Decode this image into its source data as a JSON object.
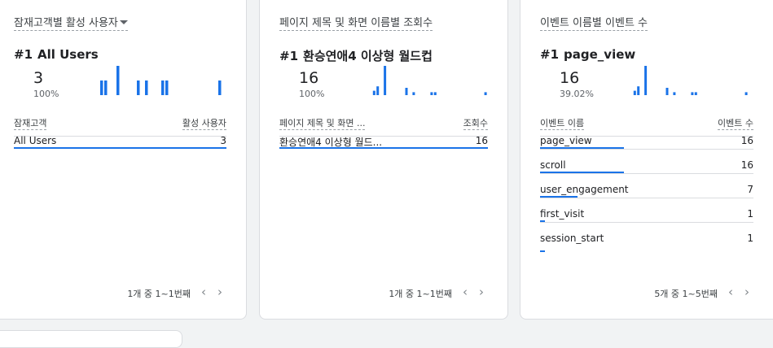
{
  "cards": [
    {
      "title": "잠재고객별 활성 사용자",
      "title_has_dropdown": true,
      "rank": "#1",
      "top_item": "All Users",
      "big_value": "3",
      "percent": "100%",
      "col_left": "잠재고객",
      "col_right": "활성 사용자",
      "rows": [
        {
          "name": "All Users",
          "value": "3",
          "share": 1.0
        }
      ],
      "pager": "1개 중 1~1번째",
      "spark": [
        0.5,
        0.5,
        0,
        0,
        1,
        0,
        0,
        0,
        0,
        0.5,
        0,
        0.5,
        0,
        0,
        0,
        0.5,
        0.5,
        0,
        0,
        0,
        0,
        0,
        0,
        0,
        0,
        0,
        0,
        0,
        0,
        0.5
      ]
    },
    {
      "title": "페이지 제목 및 화면 이름별 조회수",
      "title_has_dropdown": false,
      "rank": "#1",
      "top_item": "환승연애4 이상형 월드컵",
      "big_value": "16",
      "percent": "100%",
      "col_left": "페이지 제목 및 화면 ...",
      "col_right": "조회수",
      "rows": [
        {
          "name": "환승연애4 이상형 월드...",
          "value": "16",
          "share": 1.0
        }
      ],
      "pager": "1개 중 1~1번째",
      "spark": [
        0,
        0,
        0.15,
        0.3,
        0,
        1,
        0,
        0,
        0,
        0,
        0,
        0.25,
        0,
        0.1,
        0,
        0,
        0,
        0,
        0.1,
        0.1,
        0,
        0,
        0,
        0,
        0,
        0,
        0,
        0,
        0,
        0,
        0,
        0,
        0,
        0.1
      ]
    },
    {
      "title": "이벤트 이름별 이벤트 수",
      "title_has_dropdown": false,
      "rank": "#1",
      "top_item": "page_view",
      "big_value": "16",
      "percent": "39.02%",
      "col_left": "이벤트 이름",
      "col_right": "이벤트 수",
      "rows": [
        {
          "name": "page_view",
          "value": "16",
          "share": 1.0
        },
        {
          "name": "scroll",
          "value": "16",
          "share": 1.0
        },
        {
          "name": "user_engagement",
          "value": "7",
          "share": 0.44
        },
        {
          "name": "first_visit",
          "value": "1",
          "share": 0.06
        },
        {
          "name": "session_start",
          "value": "1",
          "share": 0.06
        }
      ],
      "pager": "5개 중 1~5번째",
      "spark": [
        0,
        0,
        0.15,
        0.3,
        0,
        1,
        0,
        0,
        0,
        0,
        0,
        0.25,
        0,
        0.1,
        0,
        0,
        0,
        0,
        0.1,
        0.1,
        0,
        0,
        0,
        0,
        0,
        0,
        0,
        0,
        0,
        0,
        0,
        0,
        0,
        0.1
      ]
    }
  ],
  "colors": {
    "accent": "#1a73e8",
    "border": "#dadce0",
    "background": "#f1f3f4"
  }
}
